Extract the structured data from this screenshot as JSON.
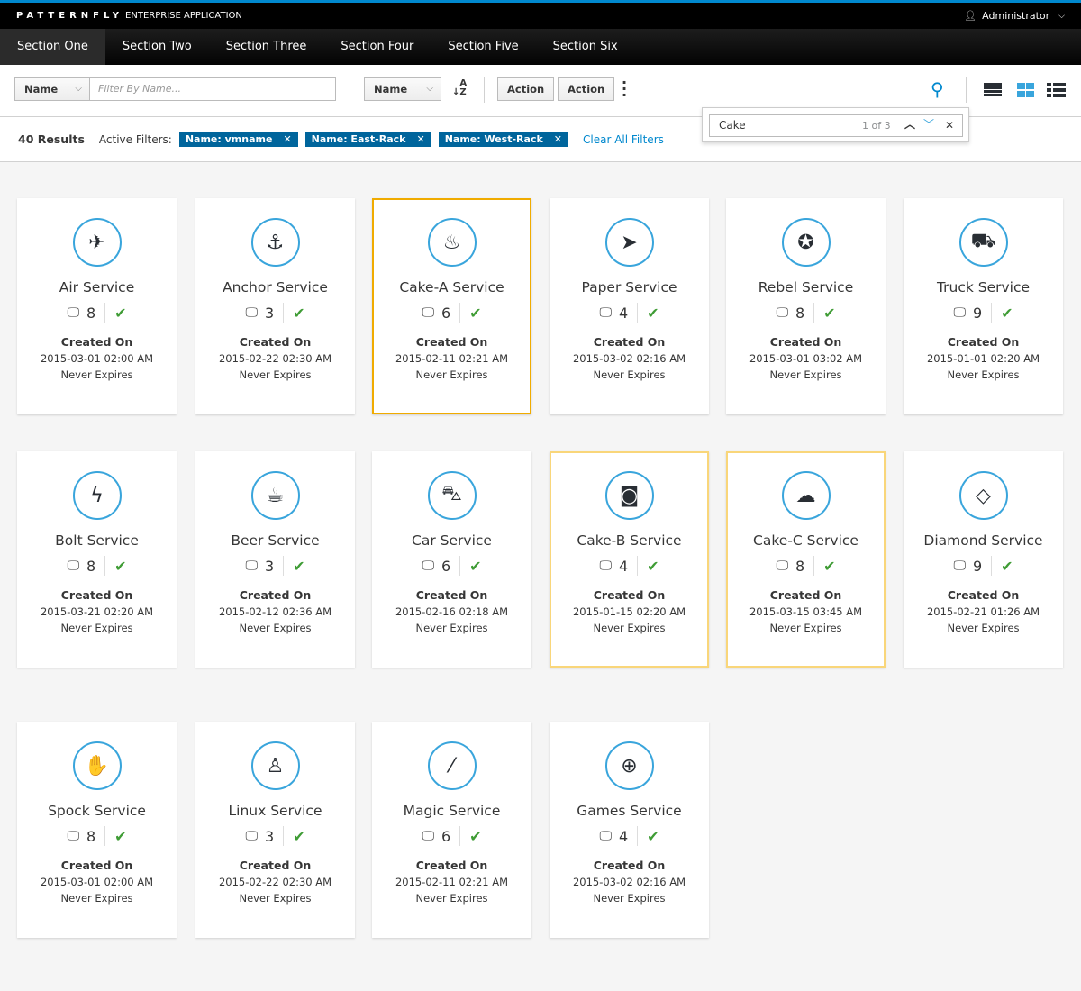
{
  "header": {
    "brand": "PATTERNFLY",
    "app": "ENTERPRISE APPLICATION",
    "user": "Administrator"
  },
  "nav": [
    "Section One",
    "Section Two",
    "Section Three",
    "Section Four",
    "Section Five",
    "Section Six"
  ],
  "toolbar": {
    "filter_field": "Name",
    "filter_placeholder": "Filter By Name...",
    "sort_field": "Name",
    "action1": "Action",
    "action2": "Action"
  },
  "filters": {
    "results": "40 Results",
    "label": "Active Filters:",
    "chips": [
      "Name: vmname",
      "Name: East-Rack",
      "Name: West-Rack"
    ],
    "clear": "Clear All Filters"
  },
  "find": {
    "value": "Cake",
    "count": "1 of 3"
  },
  "colors": {
    "accent": "#0088ce",
    "selected": "#f0ab00",
    "highlight": "#f9d67a",
    "ok": "#3f9c35"
  },
  "card_labels": {
    "created": "Created On",
    "expires": "Never Expires"
  },
  "cards": [
    {
      "name": "Air Service",
      "icon": "plane-icon",
      "glyph": "✈",
      "count": "8",
      "date": "2015-03-01 02:00 AM"
    },
    {
      "name": "Anchor Service",
      "icon": "anchor-icon",
      "glyph": "⚓",
      "count": "3",
      "date": "2015-02-22 02:30 AM"
    },
    {
      "name": "Cake-A Service",
      "icon": "birthday-cake-icon",
      "glyph": "♨",
      "count": "6",
      "date": "2015-02-11 02:21 AM",
      "state": "selected"
    },
    {
      "name": "Paper Service",
      "icon": "paper-plane-icon",
      "glyph": "➤",
      "count": "4",
      "date": "2015-03-02 02:16 AM"
    },
    {
      "name": "Rebel Service",
      "icon": "rebel-icon",
      "glyph": "✪",
      "count": "8",
      "date": "2015-03-01 03:02 AM"
    },
    {
      "name": "Truck Service",
      "icon": "truck-icon",
      "glyph": "⛟",
      "count": "9",
      "date": "2015-01-01 02:20 AM"
    },
    {
      "name": "Bolt Service",
      "icon": "bolt-icon",
      "glyph": "ϟ",
      "count": "8",
      "date": "2015-03-21 02:20 AM"
    },
    {
      "name": "Beer Service",
      "icon": "beer-icon",
      "glyph": "☕",
      "count": "3",
      "date": "2015-02-12 02:36 AM"
    },
    {
      "name": "Car Service",
      "icon": "car-icon",
      "glyph": "⛍",
      "count": "6",
      "date": "2015-02-16 02:18 AM"
    },
    {
      "name": "Cake-B Service",
      "icon": "camera-icon",
      "glyph": "◙",
      "count": "4",
      "date": "2015-01-15 02:20 AM",
      "state": "highlight"
    },
    {
      "name": "Cake-C Service",
      "icon": "cloud-icon",
      "glyph": "☁",
      "count": "8",
      "date": "2015-03-15 03:45 AM",
      "state": "highlight"
    },
    {
      "name": "Diamond Service",
      "icon": "diamond-icon",
      "glyph": "◇",
      "count": "9",
      "date": "2015-02-21 01:26 AM"
    },
    {
      "name": "Spock Service",
      "icon": "hand-spock-icon",
      "glyph": "✋",
      "count": "8",
      "date": "2015-03-01 02:00 AM"
    },
    {
      "name": "Linux Service",
      "icon": "linux-icon",
      "glyph": "♙",
      "count": "3",
      "date": "2015-02-22 02:30 AM"
    },
    {
      "name": "Magic Service",
      "icon": "magic-wand-icon",
      "glyph": "⁄",
      "count": "6",
      "date": "2015-02-11 02:21 AM"
    },
    {
      "name": "Games Service",
      "icon": "gamepad-icon",
      "glyph": "⊕",
      "count": "4",
      "date": "2015-03-02 02:16 AM"
    }
  ]
}
